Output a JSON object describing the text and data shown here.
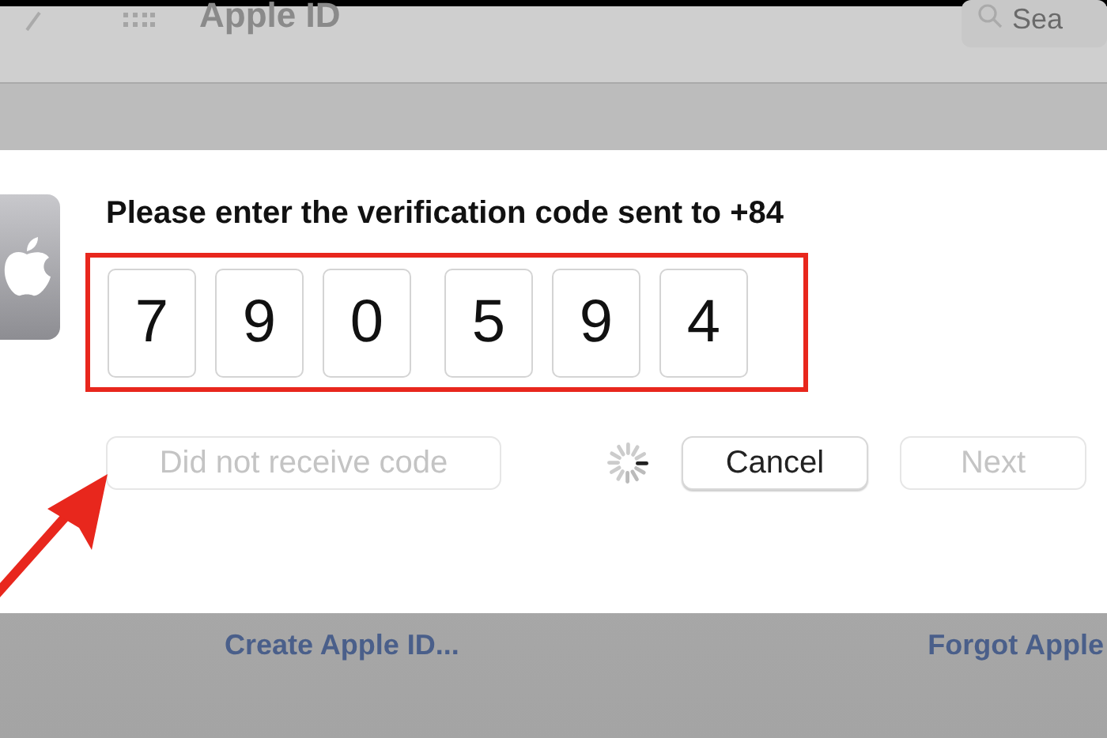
{
  "toolbar": {
    "title": "Apple ID",
    "search_placeholder": "Sea"
  },
  "dialog": {
    "message": "Please enter the verification code sent to +84",
    "code": [
      {
        "digit": "7"
      },
      {
        "digit": "9"
      },
      {
        "digit": "0"
      },
      {
        "digit": "5"
      },
      {
        "digit": "9"
      },
      {
        "digit": "4"
      }
    ],
    "buttons": [
      {
        "kind": "secondary",
        "label": "Did not receive code",
        "disabled": true
      },
      {
        "kind": "spinner"
      },
      {
        "kind": "normal",
        "label": "Cancel",
        "disabled": false
      },
      {
        "kind": "normal",
        "label": "Next",
        "disabled": true
      }
    ]
  },
  "links": [
    "Create Apple ID...",
    "Forgot Apple"
  ]
}
